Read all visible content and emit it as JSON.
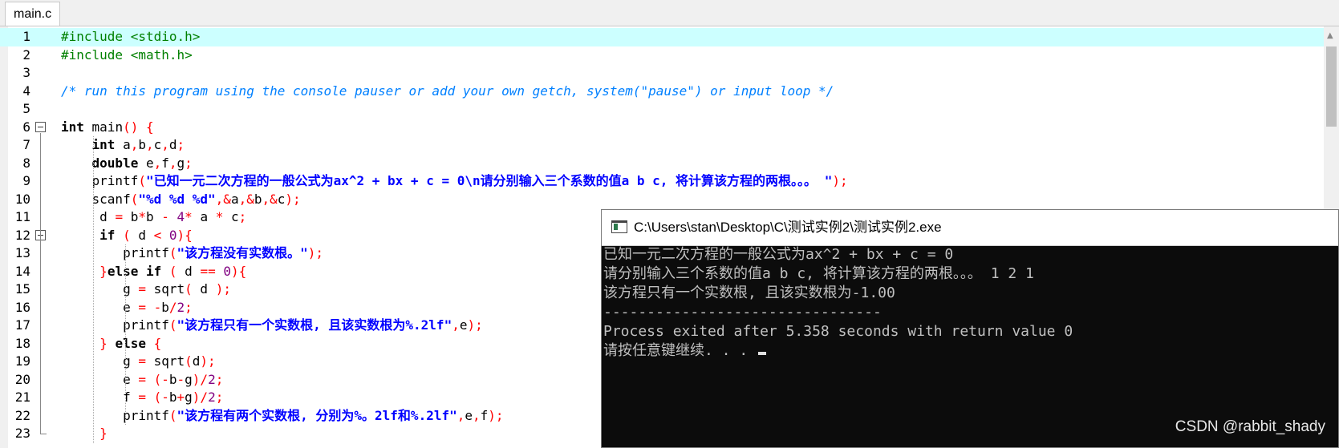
{
  "tab": {
    "label": "main.c"
  },
  "editor": {
    "lines": [
      {
        "n": "1",
        "code": [
          {
            "t": "#include <stdio.h>",
            "c": "pp"
          }
        ]
      },
      {
        "n": "2",
        "code": [
          {
            "t": "#include <math.h>",
            "c": "pp"
          }
        ]
      },
      {
        "n": "3",
        "code": []
      },
      {
        "n": "4",
        "code": [
          {
            "t": "/* run this program using the console pauser or add your own getch, system(\"pause\") or input loop */",
            "c": "cmt"
          }
        ]
      },
      {
        "n": "5",
        "code": []
      },
      {
        "n": "6",
        "code": [
          {
            "t": "int",
            "c": "kw"
          },
          {
            "t": " main"
          },
          {
            "t": "()",
            "c": "sym"
          },
          {
            "t": " "
          },
          {
            "t": "{",
            "c": "sym"
          }
        ]
      },
      {
        "n": "7",
        "code": [
          {
            "t": "    "
          },
          {
            "t": "int",
            "c": "kw"
          },
          {
            "t": " a"
          },
          {
            "t": ",",
            "c": "sym"
          },
          {
            "t": "b"
          },
          {
            "t": ",",
            "c": "sym"
          },
          {
            "t": "c"
          },
          {
            "t": ",",
            "c": "sym"
          },
          {
            "t": "d"
          },
          {
            "t": ";",
            "c": "sym"
          }
        ]
      },
      {
        "n": "8",
        "code": [
          {
            "t": "    "
          },
          {
            "t": "double",
            "c": "kw"
          },
          {
            "t": " e"
          },
          {
            "t": ",",
            "c": "sym"
          },
          {
            "t": "f"
          },
          {
            "t": ",",
            "c": "sym"
          },
          {
            "t": "g"
          },
          {
            "t": ";",
            "c": "sym"
          }
        ]
      },
      {
        "n": "9",
        "code": [
          {
            "t": "    printf"
          },
          {
            "t": "(",
            "c": "sym"
          },
          {
            "t": "\"已知一元二次方程的一般公式为ax^2 + bx + c = 0\\n请分别输入三个系数的值a b c, 将计算该方程的两根。。。 \"",
            "c": "str"
          },
          {
            "t": ");",
            "c": "sym"
          }
        ]
      },
      {
        "n": "10",
        "code": [
          {
            "t": "    scanf"
          },
          {
            "t": "(",
            "c": "sym"
          },
          {
            "t": "\"%d %d %d\"",
            "c": "str"
          },
          {
            "t": ",&",
            "c": "sym"
          },
          {
            "t": "a"
          },
          {
            "t": ",&",
            "c": "sym"
          },
          {
            "t": "b"
          },
          {
            "t": ",&",
            "c": "sym"
          },
          {
            "t": "c"
          },
          {
            "t": ");",
            "c": "sym"
          }
        ]
      },
      {
        "n": "11",
        "code": [
          {
            "t": "     d "
          },
          {
            "t": "=",
            "c": "sym"
          },
          {
            "t": " b"
          },
          {
            "t": "*",
            "c": "sym"
          },
          {
            "t": "b "
          },
          {
            "t": "-",
            "c": "sym"
          },
          {
            "t": " "
          },
          {
            "t": "4",
            "c": "num"
          },
          {
            "t": "*",
            "c": "sym"
          },
          {
            "t": " a "
          },
          {
            "t": "*",
            "c": "sym"
          },
          {
            "t": " c"
          },
          {
            "t": ";",
            "c": "sym"
          }
        ]
      },
      {
        "n": "12",
        "code": [
          {
            "t": "     "
          },
          {
            "t": "if",
            "c": "kw"
          },
          {
            "t": " "
          },
          {
            "t": "(",
            "c": "sym"
          },
          {
            "t": " d "
          },
          {
            "t": "<",
            "c": "sym"
          },
          {
            "t": " "
          },
          {
            "t": "0",
            "c": "num"
          },
          {
            "t": "){",
            "c": "sym"
          }
        ]
      },
      {
        "n": "13",
        "code": [
          {
            "t": "        printf"
          },
          {
            "t": "(",
            "c": "sym"
          },
          {
            "t": "\"该方程没有实数根。\"",
            "c": "str"
          },
          {
            "t": ");",
            "c": "sym"
          }
        ]
      },
      {
        "n": "14",
        "code": [
          {
            "t": "     "
          },
          {
            "t": "}",
            "c": "sym"
          },
          {
            "t": "else if",
            "c": "kw"
          },
          {
            "t": " "
          },
          {
            "t": "(",
            "c": "sym"
          },
          {
            "t": " d "
          },
          {
            "t": "==",
            "c": "sym"
          },
          {
            "t": " "
          },
          {
            "t": "0",
            "c": "num"
          },
          {
            "t": "){",
            "c": "sym"
          }
        ]
      },
      {
        "n": "15",
        "code": [
          {
            "t": "        g "
          },
          {
            "t": "=",
            "c": "sym"
          },
          {
            "t": " sqrt"
          },
          {
            "t": "(",
            "c": "sym"
          },
          {
            "t": " d "
          },
          {
            "t": ");",
            "c": "sym"
          }
        ]
      },
      {
        "n": "16",
        "code": [
          {
            "t": "        e "
          },
          {
            "t": "=",
            "c": "sym"
          },
          {
            "t": " "
          },
          {
            "t": "-",
            "c": "sym"
          },
          {
            "t": "b"
          },
          {
            "t": "/",
            "c": "sym"
          },
          {
            "t": "2",
            "c": "num"
          },
          {
            "t": ";",
            "c": "sym"
          }
        ]
      },
      {
        "n": "17",
        "code": [
          {
            "t": "        printf"
          },
          {
            "t": "(",
            "c": "sym"
          },
          {
            "t": "\"该方程只有一个实数根, 且该实数根为%.2lf\"",
            "c": "str"
          },
          {
            "t": ",",
            "c": "sym"
          },
          {
            "t": "e"
          },
          {
            "t": ");",
            "c": "sym"
          }
        ]
      },
      {
        "n": "18",
        "code": [
          {
            "t": "     "
          },
          {
            "t": "}",
            "c": "sym"
          },
          {
            "t": " "
          },
          {
            "t": "else",
            "c": "kw"
          },
          {
            "t": " "
          },
          {
            "t": "{",
            "c": "sym"
          }
        ]
      },
      {
        "n": "19",
        "code": [
          {
            "t": "        g "
          },
          {
            "t": "=",
            "c": "sym"
          },
          {
            "t": " sqrt"
          },
          {
            "t": "(",
            "c": "sym"
          },
          {
            "t": "d"
          },
          {
            "t": ");",
            "c": "sym"
          }
        ]
      },
      {
        "n": "20",
        "code": [
          {
            "t": "        e "
          },
          {
            "t": "=",
            "c": "sym"
          },
          {
            "t": " "
          },
          {
            "t": "(-",
            "c": "sym"
          },
          {
            "t": "b"
          },
          {
            "t": "-",
            "c": "sym"
          },
          {
            "t": "g"
          },
          {
            "t": ")/",
            "c": "sym"
          },
          {
            "t": "2",
            "c": "num"
          },
          {
            "t": ";",
            "c": "sym"
          }
        ]
      },
      {
        "n": "21",
        "code": [
          {
            "t": "        f "
          },
          {
            "t": "=",
            "c": "sym"
          },
          {
            "t": " "
          },
          {
            "t": "(-",
            "c": "sym"
          },
          {
            "t": "b"
          },
          {
            "t": "+",
            "c": "sym"
          },
          {
            "t": "g"
          },
          {
            "t": ")/",
            "c": "sym"
          },
          {
            "t": "2",
            "c": "num"
          },
          {
            "t": ";",
            "c": "sym"
          }
        ]
      },
      {
        "n": "22",
        "code": [
          {
            "t": "        printf"
          },
          {
            "t": "(",
            "c": "sym"
          },
          {
            "t": "\"该方程有两个实数根, 分别为%。2lf和%.2lf\"",
            "c": "str"
          },
          {
            "t": ",",
            "c": "sym"
          },
          {
            "t": "e"
          },
          {
            "t": ",",
            "c": "sym"
          },
          {
            "t": "f"
          },
          {
            "t": ");",
            "c": "sym"
          }
        ]
      },
      {
        "n": "23",
        "code": [
          {
            "t": "     "
          },
          {
            "t": "}",
            "c": "sym"
          }
        ]
      }
    ]
  },
  "console": {
    "title": "C:\\Users\\stan\\Desktop\\C\\测试实例2\\测试实例2.exe",
    "lines": [
      "已知一元二次方程的一般公式为ax^2 + bx + c = 0",
      "请分别输入三个系数的值a b c, 将计算该方程的两根。。。 1 2 1",
      "该方程只有一个实数根, 且该实数根为-1.00",
      "--------------------------------",
      "Process exited after 5.358 seconds with return value 0",
      "请按任意键继续. . . "
    ]
  },
  "watermark": "CSDN @rabbit_shady"
}
